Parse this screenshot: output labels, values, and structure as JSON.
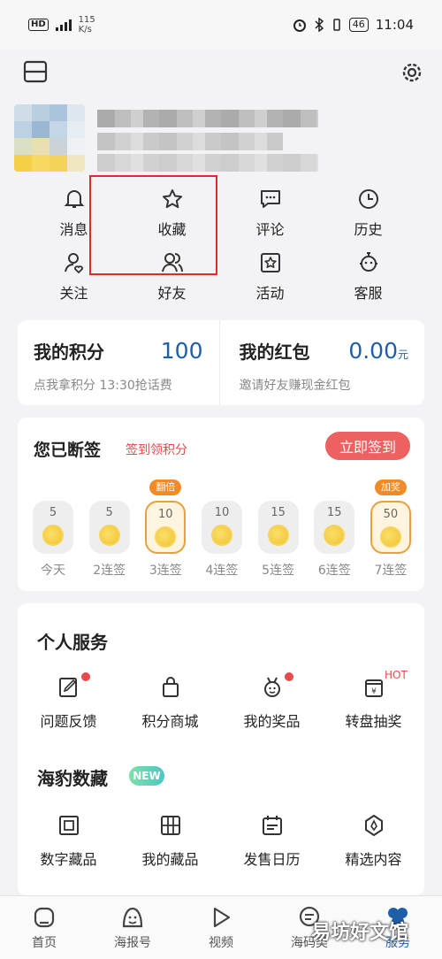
{
  "status_bar": {
    "network": "HD",
    "speed_value": "115",
    "speed_unit": "K/s",
    "battery": "46",
    "time": "11:04"
  },
  "quick_actions": [
    {
      "label": "消息",
      "icon": "bell-icon"
    },
    {
      "label": "收藏",
      "icon": "star-icon"
    },
    {
      "label": "评论",
      "icon": "comment-icon"
    },
    {
      "label": "历史",
      "icon": "clock-icon"
    },
    {
      "label": "关注",
      "icon": "user-heart-icon"
    },
    {
      "label": "好友",
      "icon": "friends-icon"
    },
    {
      "label": "活动",
      "icon": "activity-star-icon"
    },
    {
      "label": "客服",
      "icon": "customer-service-icon"
    }
  ],
  "points_card": {
    "points_title": "我的积分",
    "points_value": "100",
    "points_sub": "点我拿积分 13:30抢话费",
    "redpacket_title": "我的红包",
    "redpacket_value": "0.00",
    "redpacket_unit": "元",
    "redpacket_sub": "邀请好友赚现金红包"
  },
  "checkin": {
    "title": "您已断签",
    "subtitle": "签到领积分",
    "button": "立即签到",
    "days": [
      {
        "points": "5",
        "label": "今天",
        "badge": ""
      },
      {
        "points": "5",
        "label": "2连签",
        "badge": ""
      },
      {
        "points": "10",
        "label": "3连签",
        "badge": "翻倍"
      },
      {
        "points": "10",
        "label": "4连签",
        "badge": ""
      },
      {
        "points": "15",
        "label": "5连签",
        "badge": ""
      },
      {
        "points": "15",
        "label": "6连签",
        "badge": ""
      },
      {
        "points": "50",
        "label": "7连签",
        "badge": "加奖"
      }
    ]
  },
  "personal_services": {
    "title": "个人服务",
    "items": [
      {
        "label": "问题反馈",
        "icon": "feedback-icon",
        "dot": true,
        "hot": ""
      },
      {
        "label": "积分商城",
        "icon": "shopping-bag-icon",
        "dot": false,
        "hot": ""
      },
      {
        "label": "我的奖品",
        "icon": "medal-icon",
        "dot": true,
        "hot": ""
      },
      {
        "label": "转盘抽奖",
        "icon": "lottery-icon",
        "dot": false,
        "hot": "HOT"
      }
    ]
  },
  "digital_collection": {
    "title": "海豹数藏",
    "badge": "NEW",
    "items": [
      {
        "label": "数字藏品",
        "icon": "frame-icon"
      },
      {
        "label": "我的藏品",
        "icon": "grid-icon"
      },
      {
        "label": "发售日历",
        "icon": "calendar-icon"
      },
      {
        "label": "精选内容",
        "icon": "gem-icon"
      }
    ]
  },
  "tabs": [
    {
      "label": "首页",
      "icon": "home-icon"
    },
    {
      "label": "海报号",
      "icon": "poster-face-icon"
    },
    {
      "label": "视频",
      "icon": "play-icon"
    },
    {
      "label": "海码类",
      "icon": "chat-icon"
    },
    {
      "label": "服务",
      "icon": "service-icon"
    }
  ],
  "watermark": "易坊好文馆",
  "colors": {
    "accent": "#1f5fa8",
    "checkin_button": "#ee6161",
    "highlight_box": "#e02a2a"
  }
}
